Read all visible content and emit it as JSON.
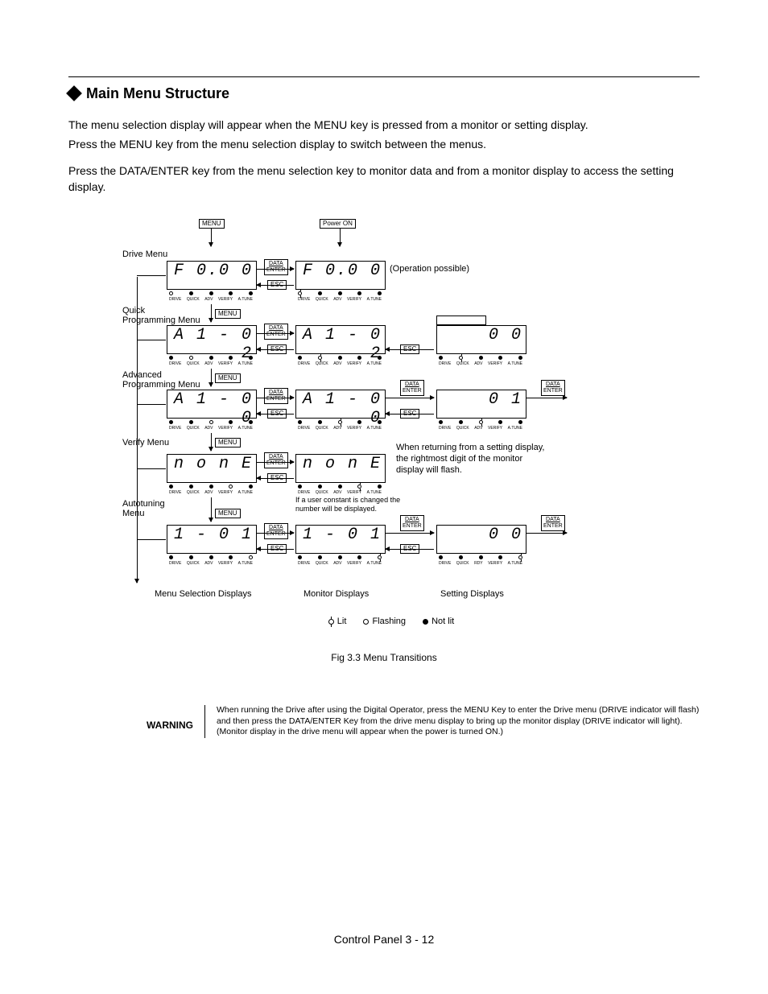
{
  "heading": "Main Menu Structure",
  "p1": "The menu selection display will appear when the MENU key is pressed from a monitor or setting display.",
  "p2": "Press the MENU key from the menu selection display to switch between the menus.",
  "p3": "Press the DATA/ENTER key from the menu selection key to monitor data and from a monitor display to access the setting display.",
  "buttons": {
    "menu": "MENU",
    "data_enter_top": "DATA",
    "data_enter_bot": "ENTER",
    "esc": "ESC",
    "power_on": "Power ON"
  },
  "row_labels": {
    "drive": "Drive Menu",
    "quick": "Quick\nProgramming Menu",
    "adv": "Advanced\nProgramming Menu",
    "verify": "Verify Menu",
    "autotune": "Autotuning\nMenu"
  },
  "notes": {
    "op_possible": "(Operation possible)",
    "return_note": "When returning from a setting display, the rightmost digit of the monitor display will flash.",
    "changed_note": "If a user constant is changed the number will be displayed."
  },
  "lcd": {
    "drive_left": "F   0.0 0",
    "drive_right": "F   0.0 0",
    "quick_left": "A 1 - 0 2",
    "quick_center": "A 1 - 0 2",
    "quick_right": "0 0",
    "adv_left": "A 1 - 0 0",
    "adv_center": "A 1 - 0 0",
    "adv_right": "0 1",
    "verify_left": "n o n E",
    "verify_center": "n o n E",
    "auto_left": "  1 - 0 1",
    "auto_center": "  1 - 0 1",
    "auto_right": "0 0"
  },
  "led_labels": [
    "DRIVE",
    "QUICK",
    "ADV",
    "VERIFY",
    "A.TUNE"
  ],
  "column_titles": {
    "a": "Menu Selection Displays",
    "b": "Monitor Displays",
    "c": "Setting Displays"
  },
  "legend": {
    "lit": "Lit",
    "flashing": "Flashing",
    "notlit": "Not lit"
  },
  "figure_caption": "Fig 3.3  Menu Transitions",
  "warning_label": "WARNING",
  "warning_text": "When running the Drive after using the Digital Operator, press the MENU Key to enter the Drive menu (DRIVE indicator will flash) and then press the DATA/ENTER Key from the drive menu display to bring up the monitor display (DRIVE indicator will light). (Monitor display in the drive menu will appear when the power is turned ON.)",
  "footer": "Control Panel  3 - 12"
}
